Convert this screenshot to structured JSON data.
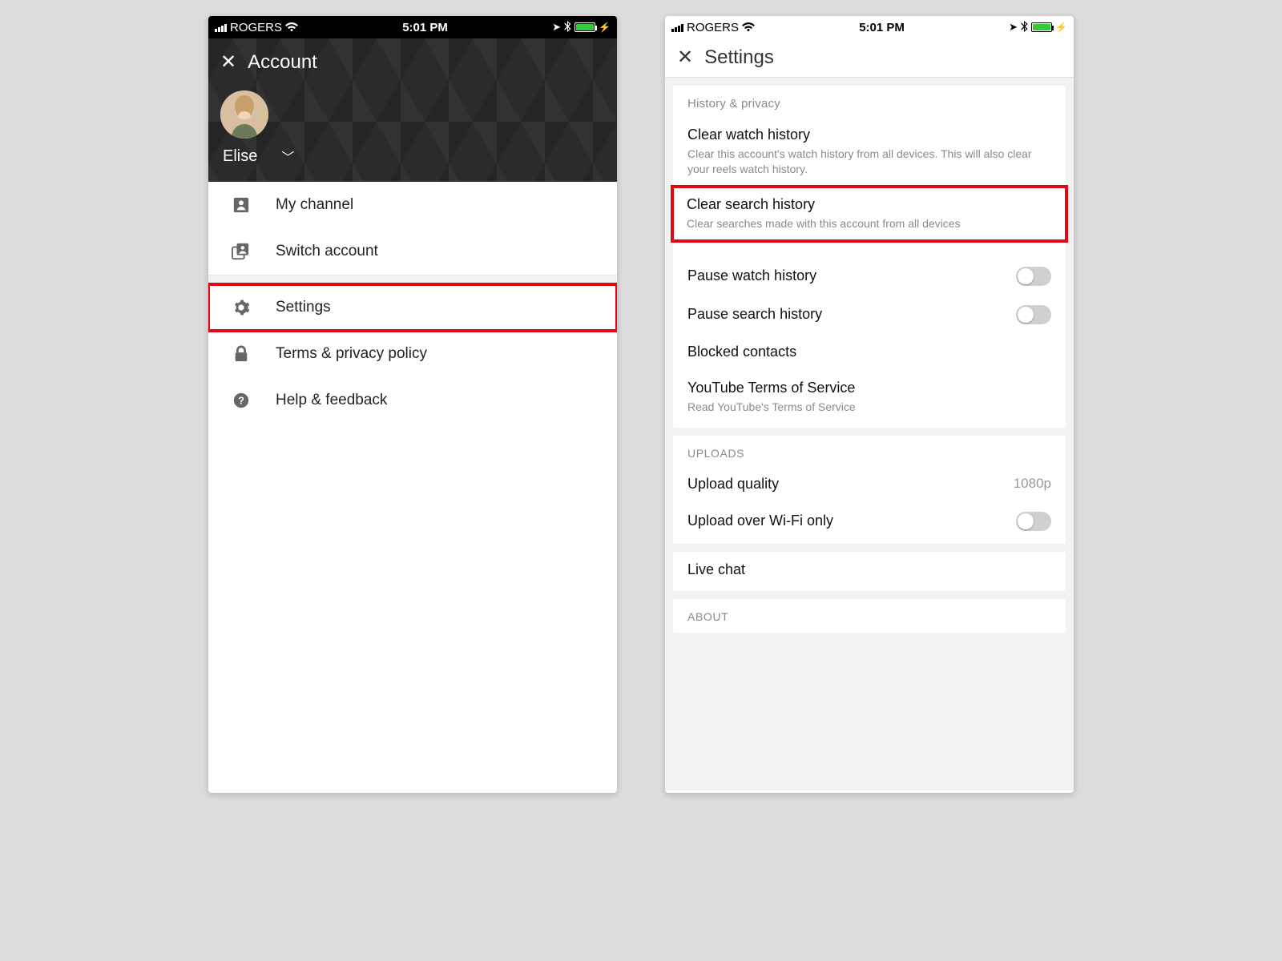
{
  "statusbar": {
    "carrier": "ROGERS",
    "time": "5:01 PM"
  },
  "phone1": {
    "title": "Account",
    "user_name": "Elise",
    "menu": {
      "my_channel": "My channel",
      "switch_account": "Switch account",
      "settings": "Settings",
      "terms": "Terms & privacy policy",
      "help": "Help & feedback"
    }
  },
  "phone2": {
    "title": "Settings",
    "sections": {
      "history_privacy": {
        "header": "History & privacy",
        "clear_watch": {
          "title": "Clear watch history",
          "sub": "Clear this account's watch history from all devices. This will also clear your reels watch history."
        },
        "clear_search": {
          "title": "Clear search history",
          "sub": "Clear searches made with this account from all devices"
        },
        "pause_watch": {
          "title": "Pause watch history"
        },
        "pause_search": {
          "title": "Pause search history"
        },
        "blocked": {
          "title": "Blocked contacts"
        },
        "tos": {
          "title": "YouTube Terms of Service",
          "sub": "Read YouTube's Terms of Service"
        }
      },
      "uploads": {
        "header": "UPLOADS",
        "quality": {
          "title": "Upload quality",
          "value": "1080p"
        },
        "wifi_only": {
          "title": "Upload over Wi-Fi only"
        }
      },
      "live_chat": {
        "title": "Live chat"
      },
      "about": {
        "header": "ABOUT"
      }
    }
  }
}
